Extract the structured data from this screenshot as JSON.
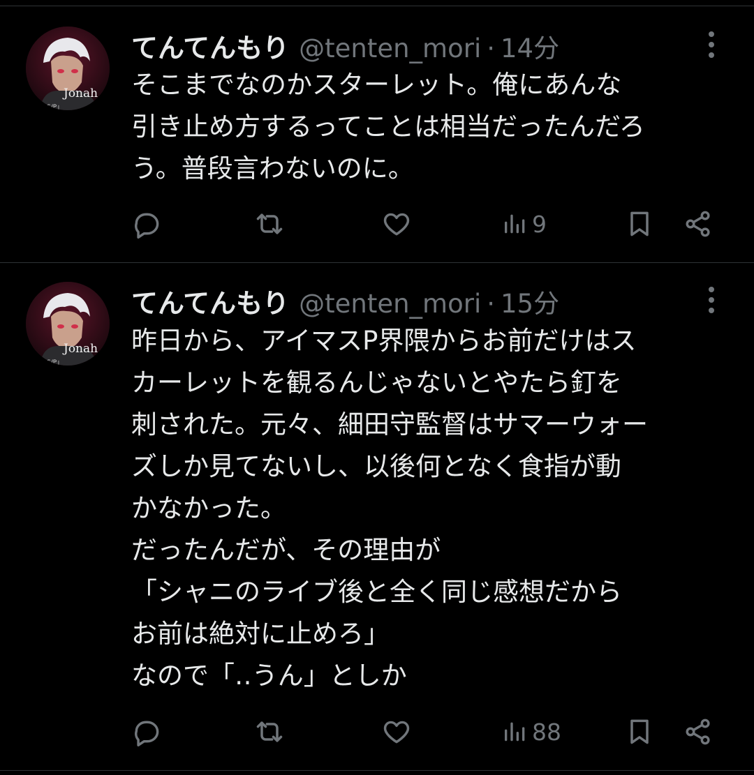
{
  "tweets": [
    {
      "name": "てんてんもり",
      "handle": "@tenten_mori",
      "separator": "·",
      "time": "14分",
      "avatar_text": "Jonah",
      "avatar_subtext": "S/P」",
      "lines": [
        "そこまでなのかスターレット。俺にあんな",
        "引き止め方するってことは相当だったんだろ",
        "う。普段言わないのに。"
      ],
      "views": "9"
    },
    {
      "name": "てんてんもり",
      "handle": "@tenten_mori",
      "separator": "·",
      "time": "15分",
      "avatar_text": "Jonah",
      "avatar_subtext": "S/P」",
      "lines": [
        "昨日から、アイマスP界隈からお前だけはス",
        "カーレットを観るんじゃないとやたら釘を",
        "刺された。元々、細田守監督はサマーウォー",
        "ズしか見てないし、以後何となく食指が動",
        "かなかった。",
        "だったんだが、その理由が",
        "「シャニのライブ後と全く同じ感想だから",
        "お前は絶対に止めろ」",
        "なので「‥うん」としか"
      ],
      "views": "88"
    }
  ],
  "icons": {
    "reply": "reply-icon",
    "retweet": "retweet-icon",
    "like": "heart-icon",
    "views": "views-icon",
    "bookmark": "bookmark-icon",
    "share": "share-icon",
    "more": "more-icon"
  },
  "colors": {
    "background": "#000000",
    "text": "#e7e9ea",
    "secondary": "#71767b",
    "divider": "#2f3336"
  }
}
